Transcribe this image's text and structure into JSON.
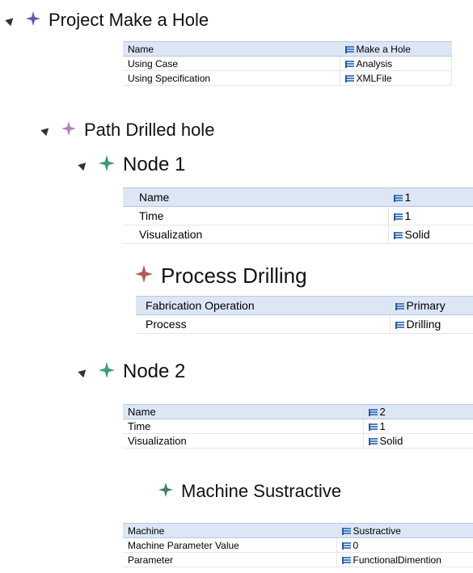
{
  "project": {
    "title": "Project Make a Hole",
    "properties": [
      {
        "name": "Name",
        "value": "Make a Hole"
      },
      {
        "name": "Using Case",
        "value": "Analysis"
      },
      {
        "name": "Using Specification",
        "value": "XMLFile"
      }
    ]
  },
  "path": {
    "title": "Path Drilled hole"
  },
  "node1": {
    "title": "Node 1",
    "properties": [
      {
        "name": "Name",
        "value": "1"
      },
      {
        "name": "Time",
        "value": "1"
      },
      {
        "name": "Visualization",
        "value": "Solid"
      }
    ],
    "process": {
      "title": "Process Drilling",
      "properties": [
        {
          "name": "Fabrication Operation",
          "value": "Primary"
        },
        {
          "name": "Process",
          "value": "Drilling"
        }
      ]
    }
  },
  "node2": {
    "title": "Node 2",
    "properties": [
      {
        "name": "Name",
        "value": "2"
      },
      {
        "name": "Time",
        "value": "1"
      },
      {
        "name": "Visualization",
        "value": "Solid"
      }
    ],
    "machine": {
      "title": "Machine Sustractive",
      "properties": [
        {
          "name": "Machine",
          "value": "Sustractive"
        },
        {
          "name": "Machine Parameter Value",
          "value": "0"
        },
        {
          "name": "Parameter",
          "value": "FunctionalDimention"
        }
      ]
    }
  },
  "colors": {
    "project_star": "#5b5ea6",
    "path_star": "#b07cc0",
    "node_star": "#3f9a7c",
    "process_star": "#b45a5a",
    "machine_star": "#3f7f6a",
    "selected_row": "#dce6f5"
  }
}
